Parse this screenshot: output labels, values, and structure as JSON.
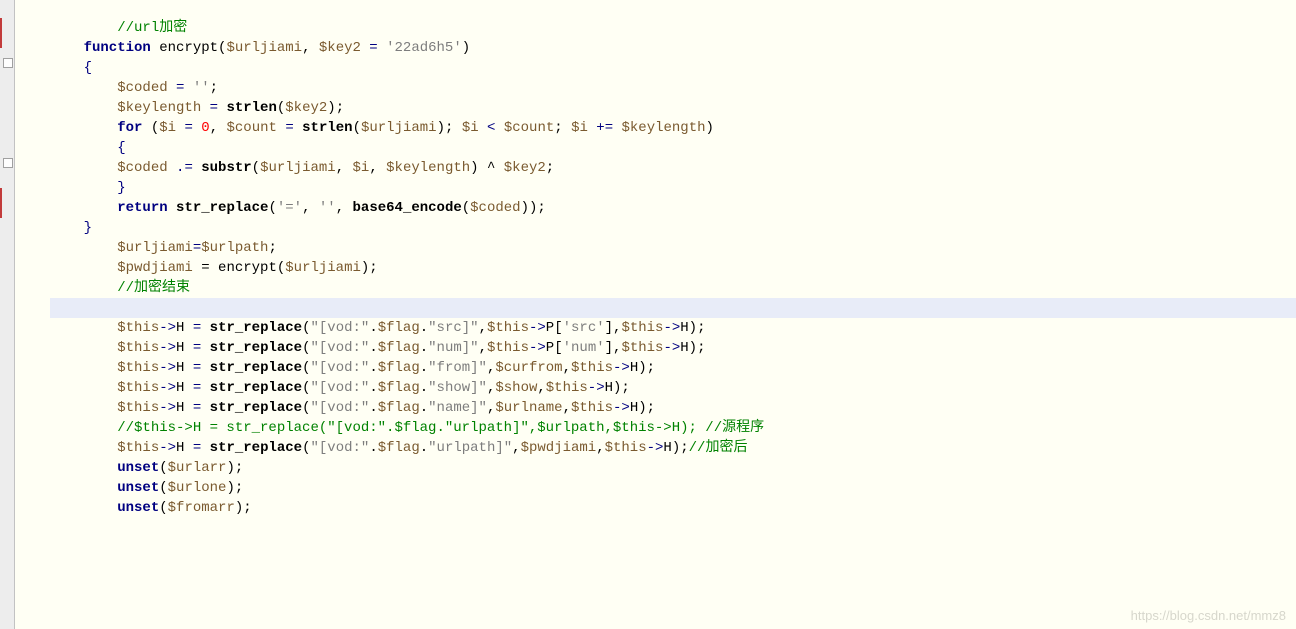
{
  "code": {
    "l1": "        //url加密",
    "l2a": "    function",
    "l2b": " encrypt(",
    "l2c": "$urljiami",
    "l2d": ", ",
    "l2e": "$key2",
    "l2f": " = ",
    "l2g": "'22ad6h5'",
    "l2h": ")",
    "l3": "    {",
    "l4a": "        ",
    "l4b": "$coded",
    "l4c": " = ",
    "l4d": "''",
    "l4e": ";",
    "l5a": "        ",
    "l5b": "$keylength",
    "l5c": " = ",
    "l5d": "strlen",
    "l5e": "(",
    "l5f": "$key2",
    "l5g": ");",
    "l6": "",
    "l7a": "        ",
    "l7b": "for",
    "l7c": " (",
    "l7d": "$i",
    "l7e": " = ",
    "l7f": "0",
    "l7g": ", ",
    "l7h": "$count",
    "l7i": " = ",
    "l7j": "strlen",
    "l7k": "(",
    "l7l": "$urljiami",
    "l7m": "); ",
    "l7n": "$i",
    "l7o": " < ",
    "l7p": "$count",
    "l7q": "; ",
    "l7r": "$i",
    "l7s": " += ",
    "l7t": "$keylength",
    "l7u": ")",
    "l8": "        {",
    "l9a": "        ",
    "l9b": "$coded",
    "l9c": " .= ",
    "l9d": "substr",
    "l9e": "(",
    "l9f": "$urljiami",
    "l9g": ", ",
    "l9h": "$i",
    "l9i": ", ",
    "l9j": "$keylength",
    "l9k": ") ^ ",
    "l9l": "$key2",
    "l9m": ";",
    "l10": "        }",
    "l11": "",
    "l12a": "        ",
    "l12b": "return",
    "l12c": " ",
    "l12d": "str_replace",
    "l12e": "(",
    "l12f": "'='",
    "l12g": ", ",
    "l12h": "''",
    "l12i": ", ",
    "l12j": "base64_encode",
    "l12k": "(",
    "l12l": "$coded",
    "l12m": "));",
    "l13": "    }",
    "l14": "",
    "l15a": "        ",
    "l15b": "$urljiami",
    "l15c": "=",
    "l15d": "$urlpath",
    "l15e": ";",
    "l16a": "        ",
    "l16b": "$pwdjiami",
    "l16c": " = encrypt(",
    "l16d": "$urljiami",
    "l16e": ");",
    "l17": "        //加密结束",
    "l18": " ",
    "l19a": "        ",
    "l19b": "$this",
    "l19c": "->",
    "l19d": "H",
    "l19e": " = ",
    "l19f": "str_replace",
    "l19g": "(",
    "l19h": "\"[vod:\"",
    "l19i": ".",
    "l19j": "$flag",
    "l19k": ".",
    "l19l": "\"src]\"",
    "l19m": ",",
    "l19n": "$this",
    "l19o": "->",
    "l19p": "P",
    "l19q": "[",
    "l19r": "'src'",
    "l19s": "],",
    "l19t": "$this",
    "l19u": "->",
    "l19v": "H",
    "l19w": ");",
    "l20a": "        ",
    "l20b": "$this",
    "l20c": "->",
    "l20d": "H",
    "l20e": " = ",
    "l20f": "str_replace",
    "l20g": "(",
    "l20h": "\"[vod:\"",
    "l20i": ".",
    "l20j": "$flag",
    "l20k": ".",
    "l20l": "\"num]\"",
    "l20m": ",",
    "l20n": "$this",
    "l20o": "->",
    "l20p": "P",
    "l20q": "[",
    "l20r": "'num'",
    "l20s": "],",
    "l20t": "$this",
    "l20u": "->",
    "l20v": "H",
    "l20w": ");",
    "l21": "",
    "l22a": "        ",
    "l22b": "$this",
    "l22c": "->",
    "l22d": "H",
    "l22e": " = ",
    "l22f": "str_replace",
    "l22g": "(",
    "l22h": "\"[vod:\"",
    "l22i": ".",
    "l22j": "$flag",
    "l22k": ".",
    "l22l": "\"from]\"",
    "l22m": ",",
    "l22n": "$curfrom",
    "l22o": ",",
    "l22p": "$this",
    "l22q": "->",
    "l22r": "H",
    "l22s": ");",
    "l23a": "        ",
    "l23b": "$this",
    "l23c": "->",
    "l23d": "H",
    "l23e": " = ",
    "l23f": "str_replace",
    "l23g": "(",
    "l23h": "\"[vod:\"",
    "l23i": ".",
    "l23j": "$flag",
    "l23k": ".",
    "l23l": "\"show]\"",
    "l23m": ",",
    "l23n": "$show",
    "l23o": ",",
    "l23p": "$this",
    "l23q": "->",
    "l23r": "H",
    "l23s": ");",
    "l24a": "        ",
    "l24b": "$this",
    "l24c": "->",
    "l24d": "H",
    "l24e": " = ",
    "l24f": "str_replace",
    "l24g": "(",
    "l24h": "\"[vod:\"",
    "l24i": ".",
    "l24j": "$flag",
    "l24k": ".",
    "l24l": "\"name]\"",
    "l24m": ",",
    "l24n": "$urlname",
    "l24o": ",",
    "l24p": "$this",
    "l24q": "->",
    "l24r": "H",
    "l24s": ");",
    "l25": "        //$this->H = str_replace(\"[vod:\".$flag.\"urlpath]\",$urlpath,$this->H); //源程序",
    "l26a": "        ",
    "l26b": "$this",
    "l26c": "->",
    "l26d": "H",
    "l26e": " = ",
    "l26f": "str_replace",
    "l26g": "(",
    "l26h": "\"[vod:\"",
    "l26i": ".",
    "l26j": "$flag",
    "l26k": ".",
    "l26l": "\"urlpath]\"",
    "l26m": ",",
    "l26n": "$pwdjiami",
    "l26o": ",",
    "l26p": "$this",
    "l26q": "->",
    "l26r": "H",
    "l26s": ");",
    "l26t": "//加密后",
    "l27": "",
    "l28a": "        ",
    "l28b": "unset",
    "l28c": "(",
    "l28d": "$urlarr",
    "l28e": ");",
    "l29a": "        ",
    "l29b": "unset",
    "l29c": "(",
    "l29d": "$urlone",
    "l29e": ");",
    "l30a": "        ",
    "l30b": "unset",
    "l30c": "(",
    "l30d": "$fromarr",
    "l30e": ");"
  },
  "watermark": "https://blog.csdn.net/mmz8"
}
